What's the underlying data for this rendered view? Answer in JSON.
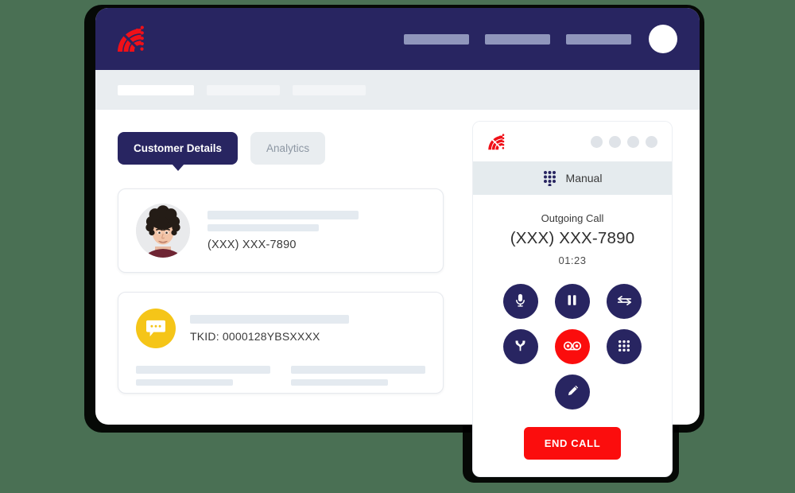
{
  "theme": {
    "background": "#4a7054",
    "navy": "#282561",
    "red": "#fb0d0d",
    "yellow": "#f5c518",
    "strip_gray": "#e9edf0",
    "placeholder_gray": "#e4eaf0"
  },
  "app": {
    "header": {
      "logo_icon": "radial-fan-logo-icon",
      "nav_items": [
        {
          "label": ""
        },
        {
          "label": ""
        },
        {
          "label": ""
        }
      ],
      "avatar_icon": "user-avatar-icon"
    },
    "breadcrumb": {
      "items": [
        {
          "label": ""
        },
        {
          "label": ""
        },
        {
          "label": ""
        }
      ]
    },
    "tabs": [
      {
        "label": "Customer Details",
        "active": true
      },
      {
        "label": "Analytics",
        "active": false
      }
    ],
    "customer_card": {
      "avatar_icon": "customer-photo",
      "name_placeholder": "",
      "subtitle_placeholder": "",
      "phone": "(XXX) XXX-7890"
    },
    "ticket_card": {
      "icon": "chat-bubble-icon",
      "title_placeholder": "",
      "ticket_id": "TKID: 0000128YBSXXXX",
      "detail_columns": [
        {
          "line1": "",
          "line2": ""
        },
        {
          "line1": "",
          "line2": ""
        }
      ]
    }
  },
  "dialer": {
    "logo_icon": "radial-fan-logo-icon",
    "window_dots": 4,
    "mode": {
      "icon": "keypad-icon",
      "label": "Manual"
    },
    "call": {
      "type": "Outgoing Call",
      "number": "(XXX) XXX-7890",
      "timer": "01:23"
    },
    "controls": [
      {
        "name": "mute-button",
        "icon": "microphone-icon",
        "style": "navy"
      },
      {
        "name": "hold-button",
        "icon": "pause-icon",
        "style": "navy"
      },
      {
        "name": "transfer-button",
        "icon": "transfer-arrows-icon",
        "style": "navy"
      },
      {
        "name": "merge-button",
        "icon": "merge-split-icon",
        "style": "navy"
      },
      {
        "name": "record-button",
        "icon": "voicemail-icon",
        "style": "red"
      },
      {
        "name": "keypad-button",
        "icon": "keypad-icon",
        "style": "navy"
      }
    ],
    "edit_button": {
      "name": "edit-button",
      "icon": "pencil-icon"
    },
    "end_call_label": "END CALL"
  }
}
